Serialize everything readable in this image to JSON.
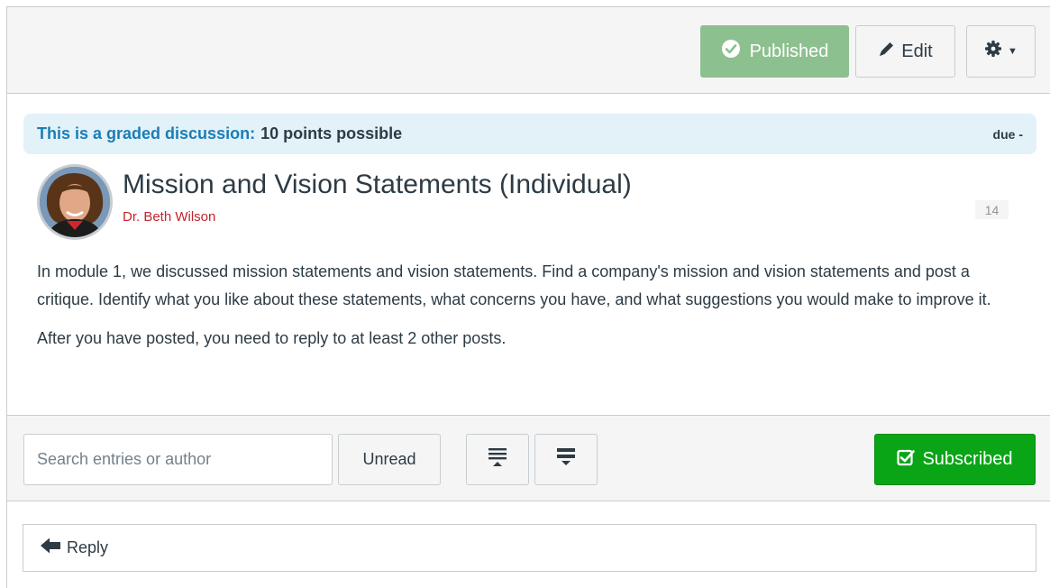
{
  "toolbar": {
    "published_label": "Published",
    "edit_label": "Edit"
  },
  "graded_banner": {
    "lead": "This is a graded discussion:",
    "points": "10 points possible",
    "due": "due -"
  },
  "topic": {
    "title": "Mission and Vision Statements (Individual)",
    "author": "Dr. Beth Wilson",
    "reply_count": "14",
    "body": [
      "In module 1, we discussed mission statements and vision statements.    Find a company's mission and vision statements and post a critique.  Identify what you like about these statements, what concerns you have, and what suggestions you would make to improve it.",
      "After you have posted, you need to reply to at least 2 other posts."
    ]
  },
  "filters": {
    "search_placeholder": "Search entries or author",
    "unread_label": "Unread",
    "subscribed_label": "Subscribed"
  },
  "reply": {
    "label": "Reply"
  },
  "colors": {
    "published_bg": "#8dc08f",
    "subscribed_bg": "#0aa517",
    "link_blue": "#1a7db6",
    "author_red": "#c4232b",
    "banner_bg": "#e3f1f8"
  }
}
